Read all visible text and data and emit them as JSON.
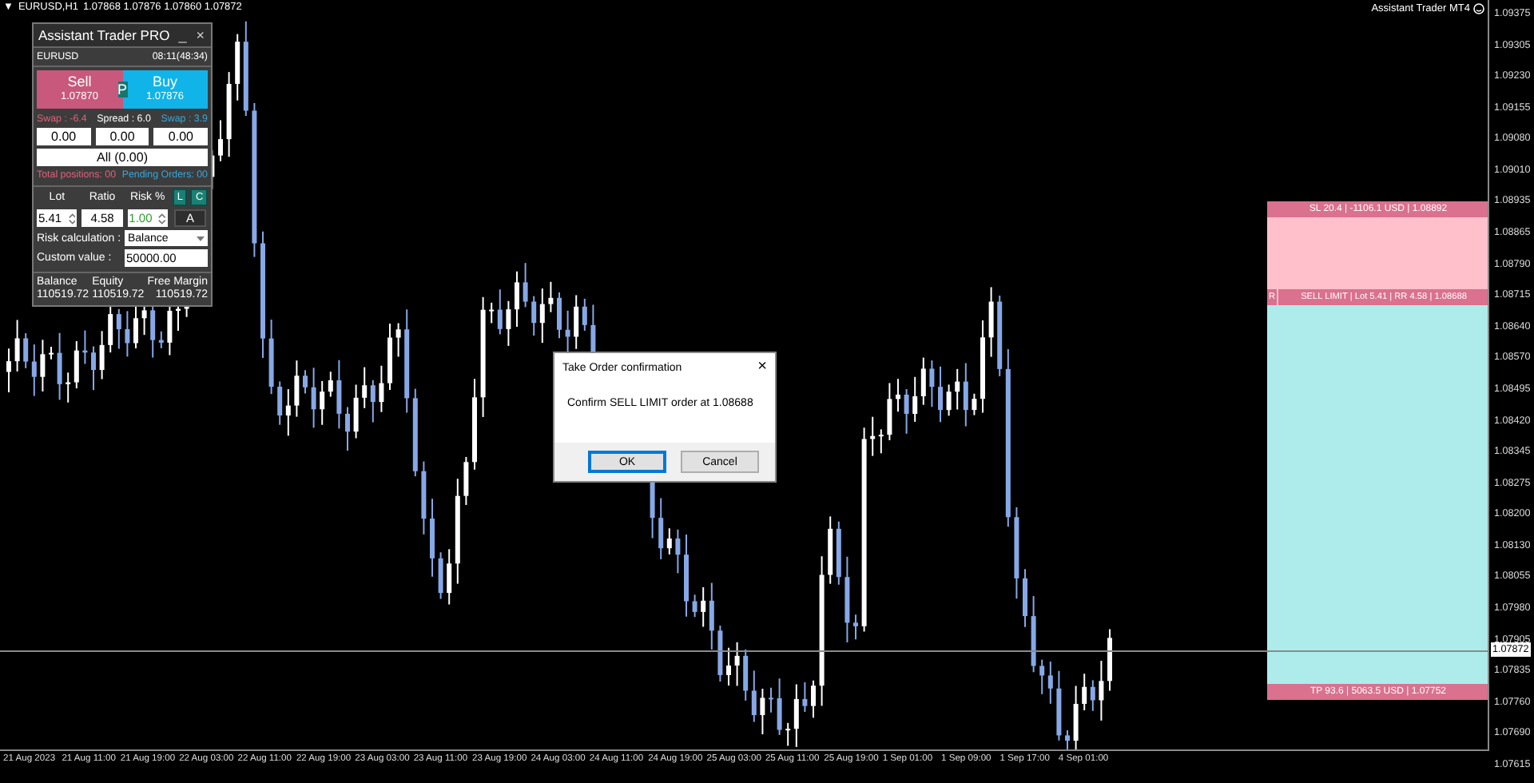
{
  "chart_header": {
    "collapse_glyph": "▼",
    "symbol": "EURUSD,H1",
    "ohlc": "1.07868 1.07876 1.07860 1.07872"
  },
  "indicator_label": "Assistant Trader MT4",
  "price_axis": [
    "1.09375",
    "1.09305",
    "1.09230",
    "1.09155",
    "1.09080",
    "1.09010",
    "1.08935",
    "1.08865",
    "1.08790",
    "1.08715",
    "1.08640",
    "1.08570",
    "1.08495",
    "1.08420",
    "1.08345",
    "1.08275",
    "1.08200",
    "1.08130",
    "1.08055",
    "1.07980",
    "1.07905",
    "1.07835",
    "1.07760",
    "1.07690",
    "1.07615"
  ],
  "current_price": "1.07872",
  "time_axis": [
    "21 Aug 2023",
    "21 Aug 11:00",
    "21 Aug 19:00",
    "22 Aug 03:00",
    "22 Aug 11:00",
    "22 Aug 19:00",
    "23 Aug 03:00",
    "23 Aug 11:00",
    "23 Aug 19:00",
    "24 Aug 03:00",
    "24 Aug 11:00",
    "24 Aug 19:00",
    "25 Aug 03:00",
    "25 Aug 11:00",
    "25 Aug 19:00",
    "1 Sep 01:00",
    "1 Sep 09:00",
    "1 Sep 17:00",
    "4 Sep 01:00"
  ],
  "panel": {
    "title": "Assistant Trader PRO",
    "minimize_glyph": "_",
    "close_glyph": "×",
    "symbol": "EURUSD",
    "time": "08:11(48:34)",
    "sell": {
      "label": "Sell",
      "price": "1.07870"
    },
    "position_badge": "P",
    "buy": {
      "label": "Buy",
      "price": "1.07876"
    },
    "swap_sell": "Swap : -6.4",
    "spread": "Spread : 6.0",
    "swap_buy": "Swap : 3.9",
    "close_fields": [
      "0.00",
      "0.00",
      "0.00"
    ],
    "close_all": "All (0.00)",
    "total_positions": "Total positions: 00",
    "pending_orders": "Pending Orders: 00",
    "lot_label": "Lot",
    "ratio_label": "Ratio",
    "risk_label": "Risk %",
    "line_button": "L",
    "clear_button": "C",
    "lot": "5.41",
    "ratio": "4.58",
    "risk": "1.00",
    "auto_button": "A",
    "risk_calc_label": "Risk calculation :",
    "risk_calc": "Balance",
    "custom_label": "Custom value :",
    "custom_value": "50000.00",
    "account": [
      {
        "label": "Balance",
        "value": "110519.72"
      },
      {
        "label": "Equity",
        "value": "110519.72"
      },
      {
        "label": "Free Margin",
        "value": "110519.72"
      }
    ]
  },
  "order_zone": {
    "stop_loss": "SL 20.4 | -1106.1 USD | 1.08892",
    "entry_tag": "R",
    "entry": "SELL LIMIT | Lot 5.41 | RR 4.58 | 1.08688",
    "take_profit": "TP 93.6 | 5063.5 USD | 1.07752"
  },
  "dialog": {
    "title": "Take Order confirmation",
    "close_glyph": "×",
    "message": "Confirm SELL LIMIT order at 1.08688",
    "buttons": [
      {
        "label": "OK",
        "selected": true
      },
      {
        "label": "Cancel",
        "selected": false
      }
    ]
  }
}
